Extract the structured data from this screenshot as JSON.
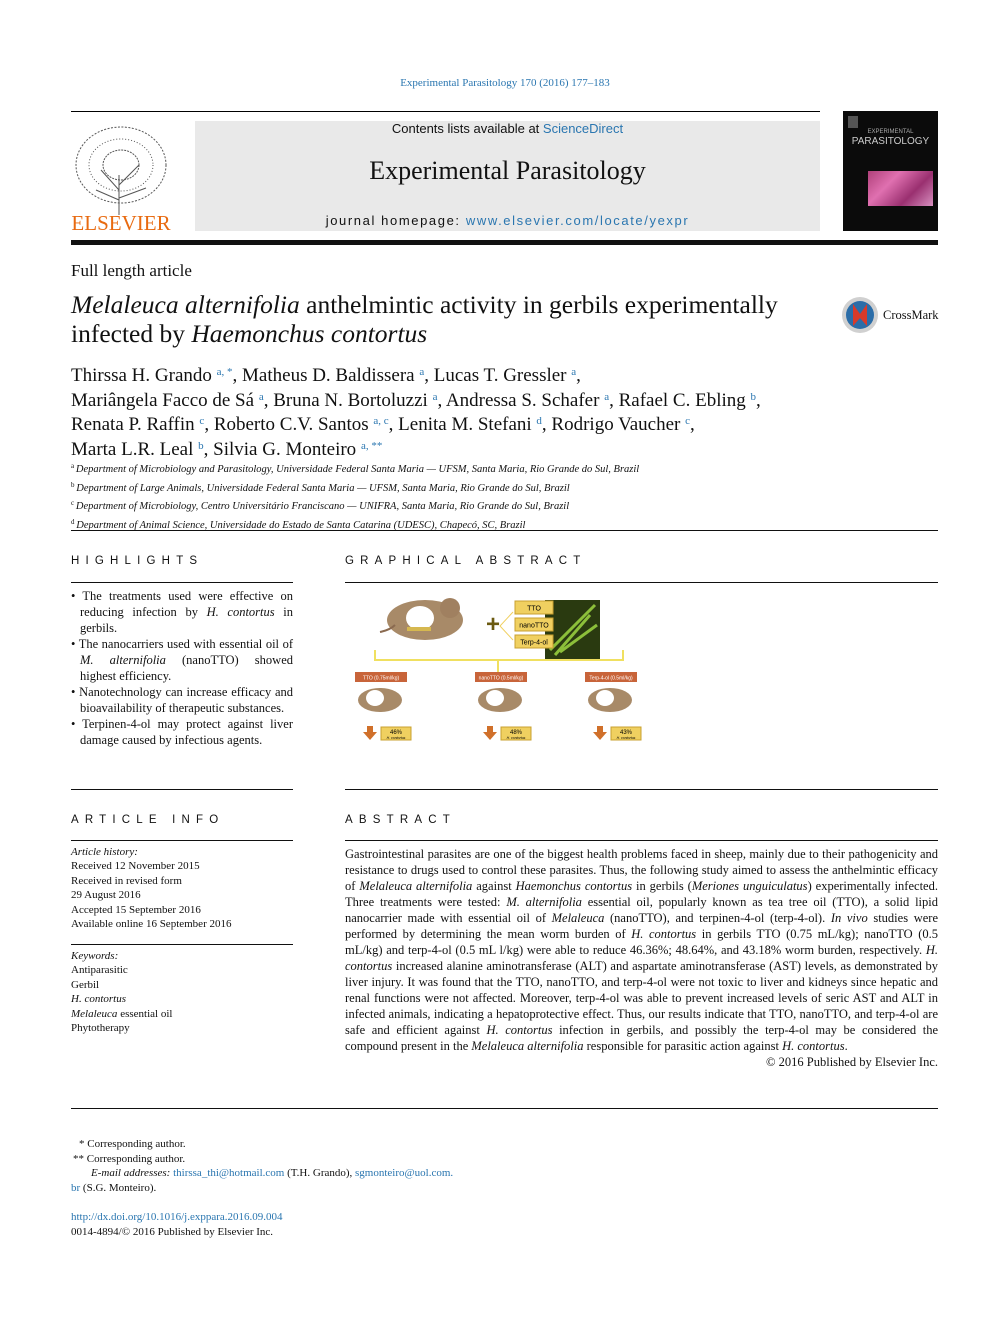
{
  "header": {
    "journal_ref": "Experimental Parasitology 170 (2016) 177–183",
    "contents_prefix": "Contents lists available at ",
    "contents_link": "ScienceDirect",
    "journal_title": "Experimental Parasitology",
    "homepage_prefix": "journal homepage: ",
    "homepage_link": "www.elsevier.com/locate/yexpr",
    "publisher_logo": "ELSEVIER",
    "cover_title": "PARASITOLOGY",
    "cover_subtitle": "EXPERIMENTAL"
  },
  "article": {
    "type": "Full length article",
    "title": [
      {
        "t": "Melaleuca alternifolia",
        "i": true
      },
      {
        "t": " anthelmintic activity in gerbils experimentally infected by "
      },
      {
        "t": "Haemonchus contortus",
        "i": true
      }
    ],
    "crossmark": "CrossMark"
  },
  "authors": [
    [
      {
        "n": "Thirssa H. Grando",
        "s": "a, *"
      },
      {
        "n": "Matheus D. Baldissera",
        "s": "a"
      },
      {
        "n": "Lucas T. Gressler",
        "s": "a"
      }
    ],
    [
      {
        "n": "Mariângela Facco de Sá",
        "s": "a"
      },
      {
        "n": "Bruna N. Bortoluzzi",
        "s": "a"
      },
      {
        "n": "Andressa S. Schafer",
        "s": "a"
      },
      {
        "n": "Rafael C. Ebling",
        "s": "b"
      }
    ],
    [
      {
        "n": "Renata P. Raffin",
        "s": "c"
      },
      {
        "n": "Roberto C.V. Santos",
        "s": "a, c"
      },
      {
        "n": "Lenita M. Stefani",
        "s": "d"
      },
      {
        "n": "Rodrigo Vaucher",
        "s": "c"
      }
    ],
    [
      {
        "n": "Marta L.R. Leal",
        "s": "b"
      },
      {
        "n": "Silvia G. Monteiro",
        "s": "a, **"
      }
    ]
  ],
  "affiliations": [
    {
      "k": "a",
      "t": "Department of Microbiology and Parasitology, Universidade Federal Santa Maria — UFSM, Santa Maria, Rio Grande do Sul, Brazil"
    },
    {
      "k": "b",
      "t": "Department of Large Animals, Universidade Federal Santa Maria — UFSM, Santa Maria, Rio Grande do Sul, Brazil"
    },
    {
      "k": "c",
      "t": "Department of Microbiology, Centro Universitário Franciscano — UNIFRA, Santa Maria, Rio Grande do Sul, Brazil"
    },
    {
      "k": "d",
      "t": "Department of Animal Science, Universidade do Estado de Santa Catarina (UDESC), Chapecó, SC, Brazil"
    }
  ],
  "highlights": {
    "heading": "HIGHLIGHTS",
    "items": [
      [
        {
          "t": "The treatments used were effective on reducing infection by "
        },
        {
          "t": "H. contortus",
          "i": true
        },
        {
          "t": " in gerbils."
        }
      ],
      [
        {
          "t": "The nanocarriers used with essential oil of "
        },
        {
          "t": "M. alternifolia",
          "i": true
        },
        {
          "t": " (nanoTTO) showed highest efficiency."
        }
      ],
      [
        {
          "t": "Nanotechnology can increase efficacy and bioavailability of therapeutic substances."
        }
      ],
      [
        {
          "t": "Terpinen-4-ol may protect against liver damage caused by infectious agents."
        }
      ]
    ]
  },
  "graphical_abstract": {
    "heading": "GRAPHICAL ABSTRACT",
    "treatments": [
      "TTO",
      "nanoTTO",
      "Terp-4-ol"
    ],
    "parasite_label": "H. contortus",
    "groups": [
      {
        "label": "TTO (0.75ml/kg)",
        "reduction": "46%"
      },
      {
        "label": "nanoTTO (0.5ml/kg)",
        "reduction": "48%"
      },
      {
        "label": "Terp-4-ol (0.5ml/kg)",
        "reduction": "43%"
      }
    ],
    "colors": {
      "label_box": "#f0d060",
      "group_header": "#c8643a",
      "arrow": "#d0702a",
      "plus": "#6b5a10"
    }
  },
  "article_info": {
    "heading": "ARTICLE INFO",
    "history_label": "Article history:",
    "history": [
      "Received 12 November 2015",
      "Received in revised form",
      "29 August 2016",
      "Accepted 15 September 2016",
      "Available online 16 September 2016"
    ],
    "keywords_label": "Keywords:",
    "keywords": [
      [
        {
          "t": "Antiparasitic"
        }
      ],
      [
        {
          "t": "Gerbil"
        }
      ],
      [
        {
          "t": "H. contortus",
          "i": true
        }
      ],
      [
        {
          "t": "Melaleuca",
          "i": true
        },
        {
          "t": " essential oil"
        }
      ],
      [
        {
          "t": "Phytotherapy"
        }
      ]
    ]
  },
  "abstract": {
    "heading": "ABSTRACT",
    "text": [
      {
        "t": "Gastrointestinal parasites are one of the biggest health problems faced in sheep, mainly due to their pathogenicity and resistance to drugs used to control these parasites. Thus, the following study aimed to assess the anthelmintic efficacy of "
      },
      {
        "t": "Melaleuca alternifolia",
        "i": true
      },
      {
        "t": " against "
      },
      {
        "t": "Haemonchus contortus",
        "i": true
      },
      {
        "t": " in gerbils ("
      },
      {
        "t": "Meriones unguiculatus",
        "i": true
      },
      {
        "t": ") experimentally infected. Three treatments were tested: "
      },
      {
        "t": "M. alternifolia",
        "i": true
      },
      {
        "t": " essential oil, popularly known as tea tree oil (TTO), a solid lipid nanocarrier made with essential oil of "
      },
      {
        "t": "Melaleuca",
        "i": true
      },
      {
        "t": " (nanoTTO), and terpinen-4-ol (terp-4-ol). "
      },
      {
        "t": "In vivo",
        "i": true
      },
      {
        "t": " studies were performed by determining the mean worm burden of "
      },
      {
        "t": "H. contortus",
        "i": true
      },
      {
        "t": " in gerbils TTO (0.75 mL/kg); nanoTTO (0.5 mL/kg) and terp-4-ol (0.5 mL l/kg) were able to reduce 46.36%; 48.64%, and 43.18% worm burden, respectively. "
      },
      {
        "t": "H. contortus",
        "i": true
      },
      {
        "t": " increased alanine aminotransferase (ALT) and aspartate aminotransferase (AST) levels, as demonstrated by liver injury. It was found that the TTO, nanoTTO, and terp-4-ol were not toxic to liver and kidneys since hepatic and renal functions were not affected. Moreover, terp-4-ol was able to prevent increased levels of seric AST and ALT in infected animals, indicating a hepatoprotective effect. Thus, our results indicate that TTO, nanoTTO, and terp-4-ol are safe and efficient against "
      },
      {
        "t": "H. contortus",
        "i": true
      },
      {
        "t": " infection in gerbils, and possibly the terp-4-ol may be considered the compound present in the "
      },
      {
        "t": "Melaleuca alternifolia",
        "i": true
      },
      {
        "t": " responsible for parasitic action against "
      },
      {
        "t": "H. contortus",
        "i": true
      },
      {
        "t": "."
      }
    ],
    "copyright": "© 2016 Published by Elsevier Inc."
  },
  "footnotes": {
    "corr1_mark": "*",
    "corr1": "Corresponding author.",
    "corr2_mark": "**",
    "corr2": "Corresponding author.",
    "email_label": "E-mail addresses:",
    "email1": "thirssa_thi@hotmail.com",
    "email1_owner": " (T.H. Grando), ",
    "email2a": "sgmonteiro@uol.com.",
    "email2b": "br",
    "email2_owner": " (S.G. Monteiro).",
    "doi": "http://dx.doi.org/10.1016/j.exppara.2016.09.004",
    "issn": "0014-4894/© 2016 Published by Elsevier Inc."
  }
}
